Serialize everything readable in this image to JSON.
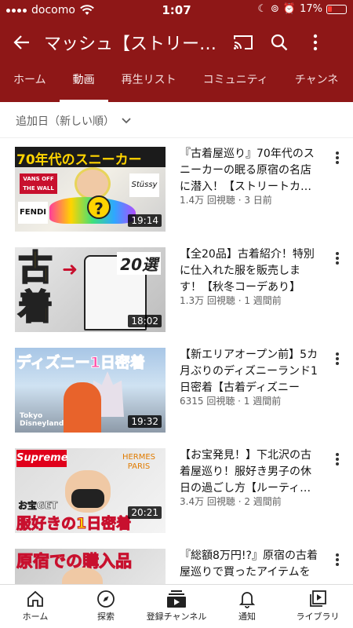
{
  "status": {
    "carrier": "docomo",
    "time": "1:07",
    "battery": "17%"
  },
  "header": {
    "title": "マッシュ【ストリー…"
  },
  "tabs": [
    "ホーム",
    "動画",
    "再生リスト",
    "コミュニティ",
    "チャンネ"
  ],
  "active_tab": 1,
  "sort": {
    "label": "追加日（新しい順）"
  },
  "videos": [
    {
      "title": "『古着屋巡り』70年代のスニーカーの眠る原宿の名店に潜入！【ストリートカ…",
      "info": "1.4万 回視聴 · 3 日前",
      "duration": "19:14",
      "thumb_text": "70年代のスニーカー",
      "thumb_badges": [
        "VANS OFF THE WALL",
        "Stüssy",
        "FENDI"
      ]
    },
    {
      "title": "【全20品】古着紹介！特別に仕入れた服を販売します！【秋冬コーデあり】",
      "info": "1.3万 回視聴 · 1 週間前",
      "duration": "18:02",
      "thumb_text": "古着",
      "thumb_badges": [
        "20選"
      ]
    },
    {
      "title": "【新エリアオープン前】5カ月ぶりのディズニーランド1日密着【古着ディズニーコ…",
      "info": "6315 回視聴 · 1 週間前",
      "duration": "19:32",
      "thumb_text": "ディズニー1日密着",
      "thumb_badges": [
        "Tokyo Disneyland"
      ]
    },
    {
      "title": "【お宝発見！】下北沢の古着屋巡り！服好き男子の休日の過ごし方【ルーティ…",
      "info": "3.4万 回視聴 · 2 週間前",
      "duration": "20:21",
      "thumb_text": "服好きの1日密着",
      "thumb_badges": [
        "Supreme",
        "HERMES PARIS",
        "お宝GET"
      ]
    },
    {
      "title": "『総額8万円!?』原宿の古着屋巡りで買ったアイテムを",
      "info": "",
      "duration": "",
      "thumb_text": "原宿での購入品",
      "thumb_badges": []
    }
  ],
  "bottom_nav": [
    "ホーム",
    "探索",
    "登録チャンネル",
    "通知",
    "ライブラリ"
  ],
  "colors": {
    "header_bg": "#8e1717",
    "text": "#111111",
    "secondary": "#606060"
  }
}
